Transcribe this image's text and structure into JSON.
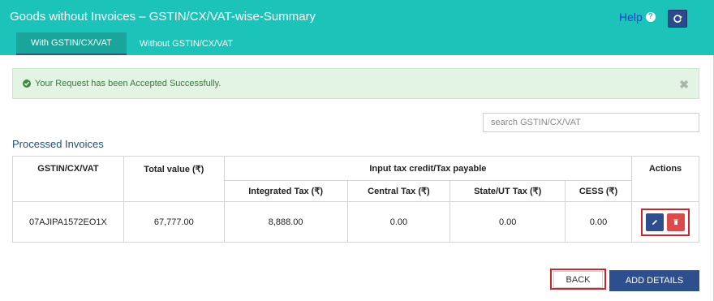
{
  "header": {
    "title": "Goods without Invoices – GSTIN/CX/VAT-wise-Summary",
    "help_label": "Help",
    "help_icon": "question-circle-icon",
    "refresh_icon": "refresh-icon",
    "background_color": "#1cc3b8"
  },
  "tabs": [
    {
      "label": "With GSTIN/CX/VAT",
      "active": true
    },
    {
      "label": "Without GSTIN/CX/VAT",
      "active": false
    }
  ],
  "alert": {
    "message": "Your Request has been Accepted Successfully.",
    "icon": "check-circle-icon",
    "close_glyph": "✖"
  },
  "search": {
    "placeholder": "search GSTIN/CX/VAT",
    "value": ""
  },
  "section_title": "Processed Invoices",
  "table": {
    "headers": {
      "gstin": "GSTIN/CX/VAT",
      "total_value": "Total value (₹)",
      "group": "Input tax credit/Tax payable",
      "integrated_tax": "Integrated Tax (₹)",
      "central_tax": "Central Tax (₹)",
      "state_ut_tax": "State/UT Tax (₹)",
      "cess": "CESS (₹)",
      "actions": "Actions"
    },
    "rows": [
      {
        "gstin": "07AJIPA1572EO1X",
        "total_value": "67,777.00",
        "integrated_tax": "8,888.00",
        "central_tax": "0.00",
        "state_ut_tax": "0.00",
        "cess": "0.00"
      }
    ]
  },
  "buttons": {
    "back_label": "BACK",
    "add_details_label": "ADD DETAILS"
  },
  "colors": {
    "accent": "#1cc3b8",
    "primary_button": "#2d4f8e",
    "delete_button": "#de4a4a",
    "highlight": "#d0232b"
  }
}
